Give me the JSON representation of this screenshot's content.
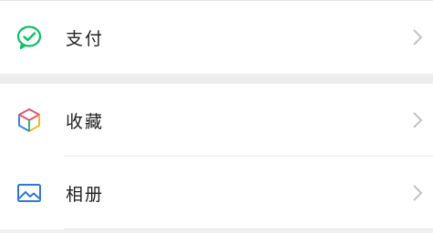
{
  "menu": {
    "items": [
      {
        "label": "支付",
        "icon": "wechat-pay-icon"
      },
      {
        "label": "收藏",
        "icon": "favorites-cube-icon"
      },
      {
        "label": "相册",
        "icon": "album-image-icon"
      }
    ]
  },
  "colors": {
    "pay_green": "#07c160",
    "album_blue": "#2f78d6",
    "chevron": "#c2c2c2"
  }
}
